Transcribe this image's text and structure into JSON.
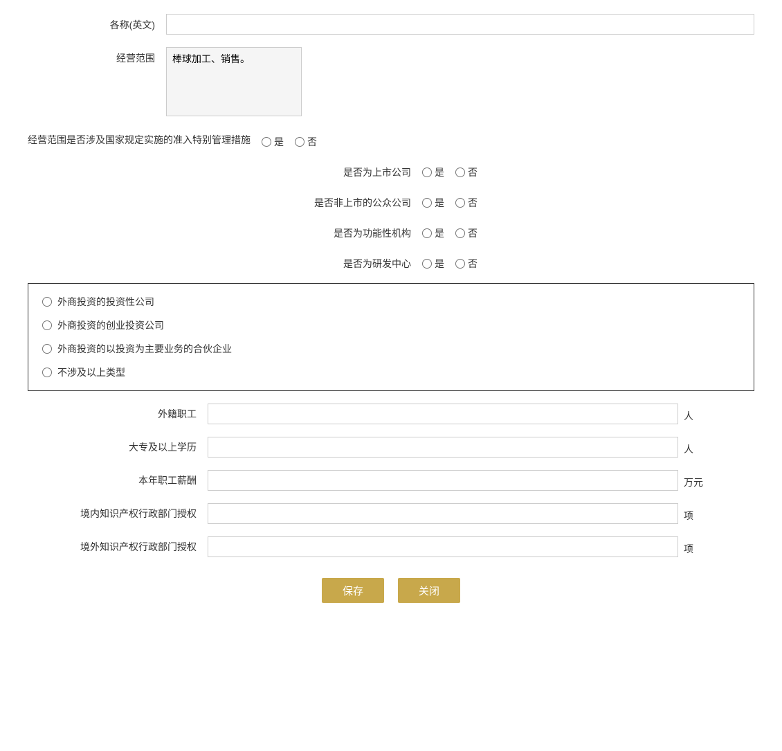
{
  "form": {
    "name_en_label": "各称(英文)",
    "name_en_placeholder": "",
    "business_scope_label": "经营范围",
    "business_scope_value": "棒球加工、销售。",
    "special_mgmt_label": "经营范围是否涉及国家规定实施的准入特别管理措施",
    "special_mgmt_yes": "是",
    "special_mgmt_no": "否",
    "listed_company_label": "是否为上市公司",
    "listed_yes": "是",
    "listed_no": "否",
    "non_listed_public_label": "是否非上市的公众公司",
    "non_listed_yes": "是",
    "non_listed_no": "否",
    "functional_org_label": "是否为功能性机构",
    "functional_yes": "是",
    "functional_no": "否",
    "rd_center_label": "是否为研发中心",
    "rd_yes": "是",
    "rd_no": "否",
    "foreign_investment_options": [
      "外商投资的投资性公司",
      "外商投资的创业投资公司",
      "外商投资的以投资为主要业务的合伙企业",
      "不涉及以上类型"
    ],
    "foreign_staff_label": "外籍职工",
    "foreign_staff_unit": "人",
    "foreign_staff_value": "",
    "college_edu_label": "大专及以上学历",
    "college_edu_unit": "人",
    "college_edu_value": "",
    "annual_salary_label": "本年职工薪酬",
    "annual_salary_unit": "万元",
    "annual_salary_value": "",
    "domestic_ip_label": "境内知识产权行政部门授权",
    "domestic_ip_unit": "项",
    "domestic_ip_value": "",
    "foreign_ip_label": "境外知识产权行政部门授权",
    "foreign_ip_unit": "项",
    "foreign_ip_value": "",
    "save_button": "保存",
    "close_button": "关闭"
  }
}
